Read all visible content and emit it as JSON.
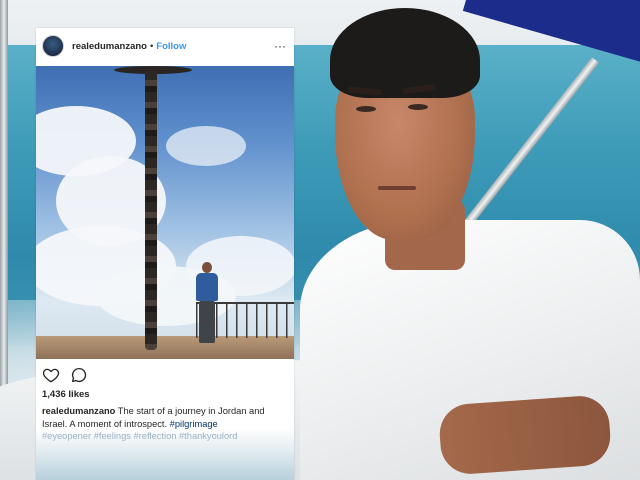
{
  "post": {
    "username": "realedumanzano",
    "separator": "•",
    "follow_label": "Follow",
    "more_label": "···",
    "likes": "1,436 likes",
    "caption": {
      "user": "realedumanzano",
      "text_line1": " The start of a journey in Jordan and",
      "text_line2": "Israel. A moment of introspect.",
      "tags": [
        "#pilgrimage",
        "#eyeopener",
        "#feelings",
        "#reflection",
        "#thankyoulord"
      ]
    }
  },
  "icons": {
    "like": "heart-icon",
    "comment": "comment-icon",
    "more": "more-options-icon",
    "avatar": "profile-avatar"
  },
  "colors": {
    "follow": "#3897f0",
    "hashtag": "#003569",
    "text": "#262626"
  }
}
